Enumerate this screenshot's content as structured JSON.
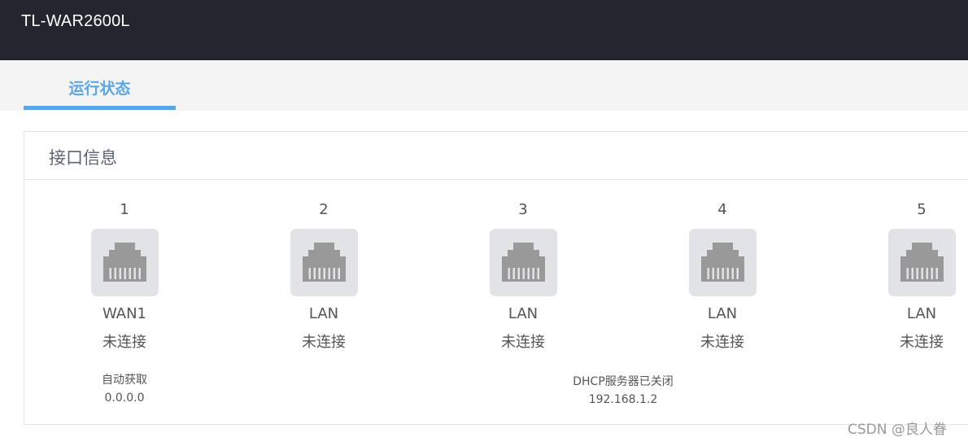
{
  "header": {
    "title": "TL-WAR2600L"
  },
  "tabs": [
    {
      "label": "运行状态"
    }
  ],
  "panel": {
    "title": "接口信息",
    "ports": [
      {
        "number": "1",
        "type": "WAN1",
        "status": "未连接"
      },
      {
        "number": "2",
        "type": "LAN",
        "status": "未连接"
      },
      {
        "number": "3",
        "type": "LAN",
        "status": "未连接"
      },
      {
        "number": "4",
        "type": "LAN",
        "status": "未连接"
      },
      {
        "number": "5",
        "type": "LAN",
        "status": "未连接"
      }
    ],
    "wan_info": {
      "mode": "自动获取",
      "ip": "0.0.0.0"
    },
    "lan_info": {
      "dhcp": "DHCP服务器已关闭",
      "ip": "192.168.1.2"
    }
  },
  "icons": {
    "port": "ethernet-port-icon"
  },
  "colors": {
    "header_bg": "#252530",
    "accent": "#5ba6ea",
    "port_icon": "#999999",
    "port_box": "#e2e3e6"
  },
  "watermark": "CSDN @良人眷"
}
